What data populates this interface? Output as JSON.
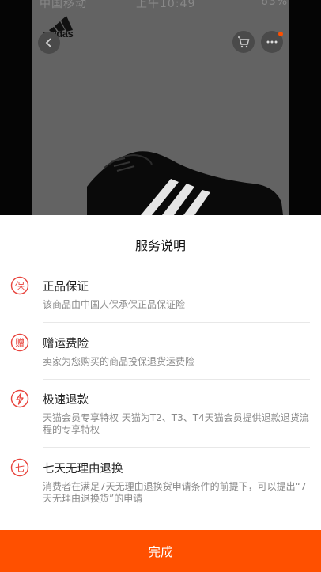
{
  "statusbar": {
    "left": "中国移动",
    "center": "上午10:49",
    "right": "63%"
  },
  "product": {
    "brand_logo": "adidas"
  },
  "nav": {
    "back_icon": "chevron-left-icon",
    "cart_icon": "shopping-cart-icon",
    "more_icon": "more-dots-icon"
  },
  "sheet": {
    "title": "服务说明",
    "items": [
      {
        "icon": "shield-bao-icon",
        "icon_char": "保",
        "title": "正品保证",
        "desc": "该商品由中国人保承保正品保证险"
      },
      {
        "icon": "gift-zeng-icon",
        "icon_char": "赠",
        "title": "赠运费险",
        "desc": "卖家为您购买的商品投保退货运费险"
      },
      {
        "icon": "lightning-icon",
        "title": "极速退款",
        "desc": "天猫会员专享特权 天猫为T2、T3、T4天猫会员提供退款退货流程的专享特权"
      },
      {
        "icon": "seven-day-icon",
        "icon_char": "七",
        "title": "七天无理由退换",
        "desc": "消费者在满足7天无理由退换货申请条件的前提下，可以提出“7天无理由退换货”的申请"
      }
    ],
    "done_label": "完成"
  },
  "colors": {
    "accent": "#ff5000",
    "icon_red": "#e8433c",
    "overlay": "#000000"
  }
}
